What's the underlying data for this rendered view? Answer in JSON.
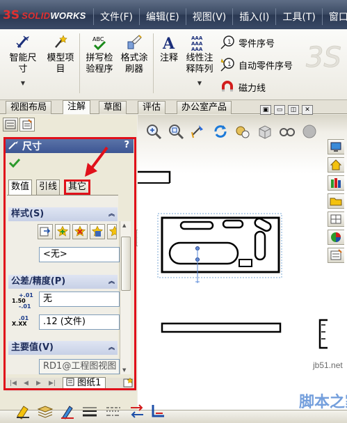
{
  "app": {
    "logo_mark": "3S",
    "logo_brand_a": "SOLID",
    "logo_brand_b": "WORKS"
  },
  "menu": [
    "文件(F)",
    "编辑(E)",
    "视图(V)",
    "插入(I)",
    "工具(T)",
    "窗口("
  ],
  "ribbon": {
    "smart_dimension": [
      "智能尺",
      "寸"
    ],
    "model_items": [
      "模型项",
      "目"
    ],
    "spell_checker": [
      "拼写检",
      "验程序"
    ],
    "format_painter": [
      "格式涂",
      "刷器"
    ],
    "note": "注释",
    "linear_note_pattern": [
      "线性注",
      "释阵列"
    ],
    "balloon": "零件序号",
    "auto_balloon": "自动零件序号",
    "magnetic_line": "磁力线"
  },
  "command_tabs": [
    "视图布局",
    "注解",
    "草图",
    "评估",
    "办公室产品"
  ],
  "active_command_tab": "注解",
  "property_manager": {
    "title": "尺寸",
    "help": "?",
    "tabs": [
      "数值",
      "引线",
      "其它"
    ],
    "active_tab": "数值",
    "highlighted_tab": "其它",
    "style_section": "样式(S)",
    "style_value": "<无>",
    "tolerance_section": "公差/精度(P)",
    "tolerance_type": "无",
    "tol_icon_top": [
      "+.01",
      "1.50",
      "-.01"
    ],
    "precision_icon": [
      "X.XX",
      ".01"
    ],
    "precision_value": ".12 (文件)",
    "primary_section": "主要值(V)",
    "primary_value": "RD1@工程图视图"
  },
  "sheet_tab": "图纸1",
  "watermark": {
    "site": "jb51.net",
    "name": "脚本之家"
  },
  "colors": {
    "highlight_red": "#e0101a",
    "title_blue": "#3d5693",
    "menu_dark": "#2a3852"
  }
}
